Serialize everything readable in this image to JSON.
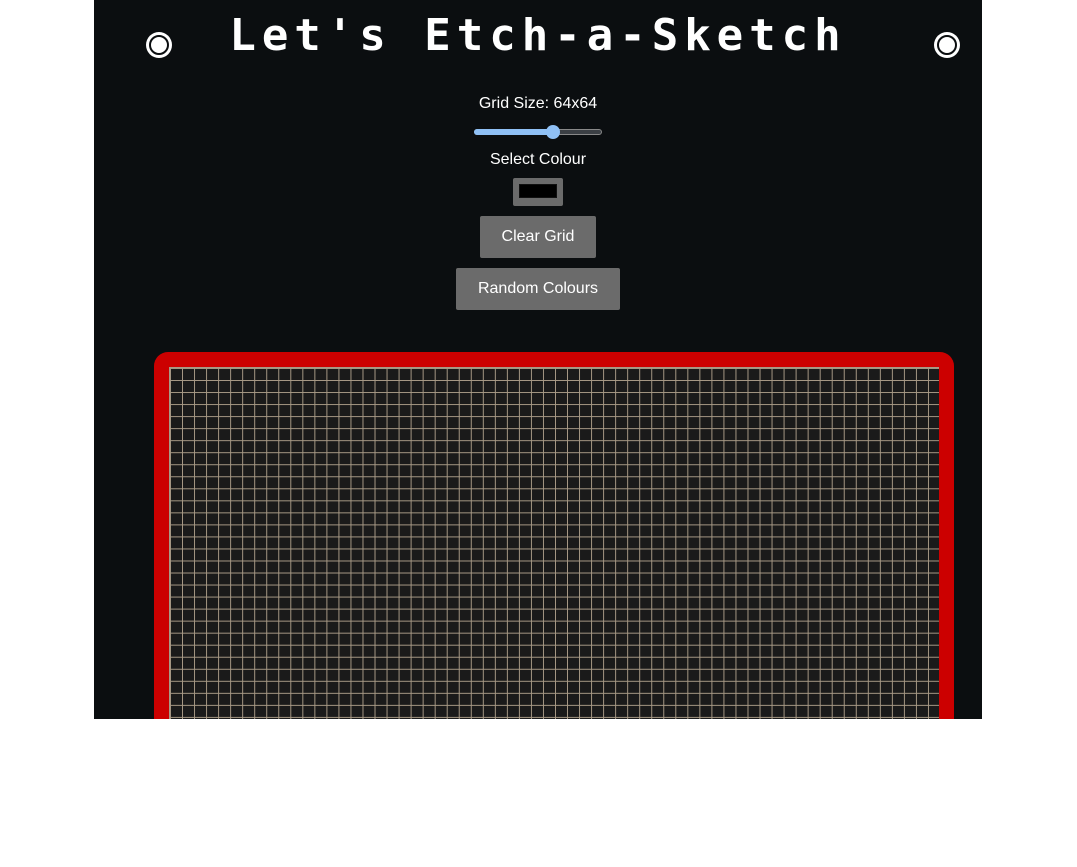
{
  "header": {
    "title": "Let's Etch-a-Sketch"
  },
  "controls": {
    "grid_size_label": "Grid Size: 64x64",
    "grid_size_value": 64,
    "grid_size_fraction": 0.62,
    "select_colour_label": "Select Colour",
    "selected_colour": "#000000",
    "clear_button": "Clear Grid",
    "random_button": "Random Colours"
  },
  "colors": {
    "app_background": "#0b0e10",
    "frame": "#cc0000",
    "grid_lines": "#a89a86",
    "button": "#6b6b6b",
    "slider_accent": "#8fc0f5"
  },
  "grid": {
    "columns": 64,
    "rows": 64
  }
}
